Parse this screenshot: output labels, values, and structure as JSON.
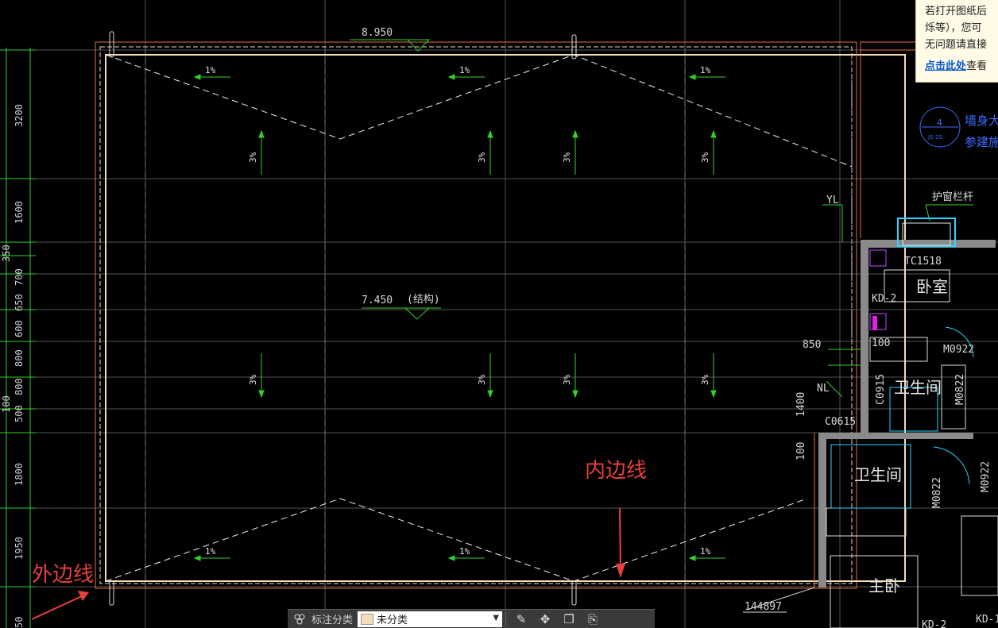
{
  "drawing": {
    "top_elevation": "8.950",
    "struct_elevation": "7.450",
    "struct_note": "(结构)",
    "slope_1": "1%",
    "slope_3": "3%",
    "dims_left": [
      "3200",
      "1600",
      "350",
      "700",
      "650",
      "600",
      "800",
      "800",
      "500",
      "100",
      "1800",
      "1950",
      "50"
    ],
    "dim_850": "850",
    "dim_1400": "1400",
    "dim_100a": "100",
    "dim_100b": "100",
    "dim_bottom": "144897",
    "labels": {
      "yl": "YL",
      "nl": "NL",
      "window_tc": "TC1518",
      "kd2": "KD-2",
      "m0922_a": "M0922",
      "m0822_a": "M0822",
      "c0915": "C0915",
      "c0615": "C0615",
      "m0822_b": "M0822",
      "m0922_b": "M0922",
      "kd2_b": "KD-2",
      "kd1": "KD-1",
      "railing": "护窗栏杆",
      "wall_note_1": "墙身大",
      "wall_note_2": "参建施",
      "detail_num": "4",
      "detail_sheet": "JS-25"
    },
    "rooms": {
      "bedroom": "卧室",
      "bath1": "卫生间",
      "bath2": "卫生间",
      "master": "主卧"
    }
  },
  "annotations": {
    "inner_edge": "内边线",
    "outer_edge": "外边线"
  },
  "tip": {
    "line1": "若打开图纸后",
    "line2": "烁等），您可",
    "line3": "无问题请直接",
    "link": "点击此处",
    "after_link": "查看"
  },
  "toolbar": {
    "label": "标注分类",
    "select_value": "未分类"
  },
  "colors": {
    "outer_line": "#e07040",
    "inner_line": "#f5dcb8",
    "grid": "#5a5a5a",
    "green_dim": "#2fd12f",
    "annotation_red": "#e8403a"
  }
}
